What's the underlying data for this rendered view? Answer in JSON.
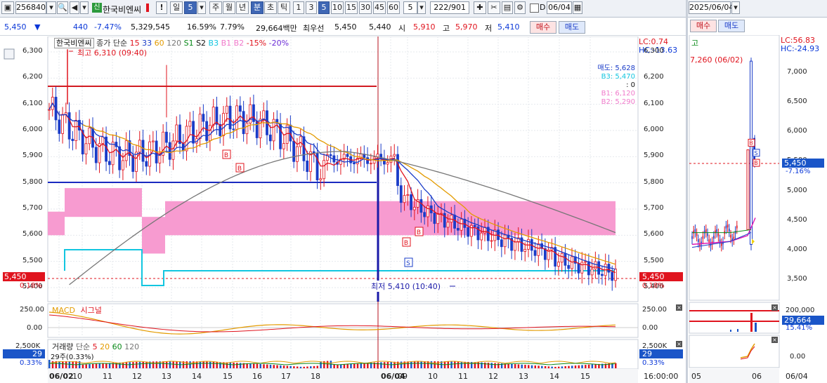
{
  "toolbar": {
    "code": "256840",
    "badge": "신",
    "name": "한국비엔씨",
    "warn": "!",
    "period_type": "일",
    "period_value": "5",
    "periods": [
      "주",
      "월",
      "년",
      "분",
      "초",
      "틱"
    ],
    "minutes": [
      "1",
      "3",
      "5",
      "10",
      "15",
      "30",
      "45",
      "60"
    ],
    "minute_box": "5",
    "count": "222/901",
    "checkbox_label": "D",
    "date": "06/04"
  },
  "toolbar_right": {
    "date": "2025/06/04"
  },
  "quote": {
    "price": "5,450",
    "arrow": "▼",
    "change": "440",
    "change_pct": "-7.47%",
    "volume": "5,329,545",
    "turnover_pct": "16.59%",
    "ratio": "7.79%",
    "amount": "29,664백만",
    "best_label": "최우선",
    "bid": "5,450",
    "ask": "5,440",
    "open_label": "시",
    "open": "5,910",
    "high_label": "고",
    "high": "5,970",
    "low_label": "저",
    "low": "5,410",
    "buy": "매수",
    "sell": "매도"
  },
  "main_chart": {
    "legend_name": "한국비엔씨",
    "legend_items": [
      {
        "text": "종가 단순",
        "color": "#333333"
      },
      {
        "text": "15",
        "color": "#e0141e"
      },
      {
        "text": "33",
        "color": "#1a3cc8"
      },
      {
        "text": "60",
        "color": "#e39b00"
      },
      {
        "text": "120",
        "color": "#777777"
      },
      {
        "text": "S1",
        "color": "#0a8a1a"
      },
      {
        "text": "S2",
        "color": "#111111"
      },
      {
        "text": "B3",
        "color": "#12c6e0"
      },
      {
        "text": "B1",
        "color": "#f07acb"
      },
      {
        "text": "B2",
        "color": "#f07acb"
      },
      {
        "text": "-15%",
        "color": "#e0141e"
      },
      {
        "text": "-20%",
        "color": "#6a2bd6"
      }
    ],
    "lc": "LC:0.74",
    "hc": "HC:-13.63",
    "high_note": "최고 6,310 (09:40)",
    "low_note": "최저 5,410 (10:40)",
    "panel_info": [
      {
        "text": "매도: 5,628",
        "color": "#1a3cc8"
      },
      {
        "text": "B3: 5,470",
        "color": "#12c6e0"
      },
      {
        "text": ": 0",
        "color": "#111111"
      },
      {
        "text": "B1: 6,120",
        "color": "#f07acb"
      },
      {
        "text": "B2: 5,290",
        "color": "#f07acb"
      }
    ],
    "y_ticks": [
      "6,300",
      "6,200",
      "6,100",
      "6,000",
      "5,900",
      "5,800",
      "5,700",
      "5,600",
      "5,500",
      "5,400"
    ],
    "price_tag": "5,450",
    "price_tag_pct": "0.18%",
    "x_labels": [
      "06/02",
      "10",
      "11",
      "12",
      "13",
      "14",
      "15",
      "16",
      "17",
      "18",
      "06/04",
      "09",
      "10",
      "11",
      "12",
      "13",
      "14",
      "15"
    ],
    "right_time": "16:00:00"
  },
  "macd": {
    "title": "MACD",
    "signal": "시그널",
    "y_ticks": [
      "250.00",
      "0.00",
      "-250.00"
    ]
  },
  "volume": {
    "title": "거래량",
    "legend": [
      "단순",
      "5",
      "20",
      "60",
      "120"
    ],
    "y_tick": "2,500K",
    "tag_value": "29",
    "tag_pct": "0.33%",
    "label": "29주(0.33%)"
  },
  "mini_chart": {
    "lc": "LC:56.83",
    "hc": "HC:-24.93",
    "label": "고",
    "buy": "매수",
    "sell": "매도",
    "high_note": "7,260 (06/02)",
    "y_ticks": [
      "7,000",
      "6,500",
      "6,000",
      "5,500",
      "5,000",
      "4,500",
      "4,000",
      "3,500"
    ],
    "price_tag": "5,450",
    "price_pct": "-7.16%",
    "vol_ticks": [
      "200,000",
      "0.00"
    ],
    "vol_tag": "29,664",
    "vol_pct": "15.41%",
    "x_labels": [
      "05",
      "06",
      "06/04"
    ]
  },
  "chart_data": {
    "type": "line",
    "title": "",
    "series": [
      {
        "name": "15",
        "color": "#e0141e"
      },
      {
        "name": "33",
        "color": "#1a3cc8"
      },
      {
        "name": "60",
        "color": "#e39b00"
      },
      {
        "name": "120",
        "color": "#777777"
      }
    ],
    "ylim": [
      5400,
      6300
    ],
    "high": 6310,
    "low": 5410,
    "last": 5450
  }
}
